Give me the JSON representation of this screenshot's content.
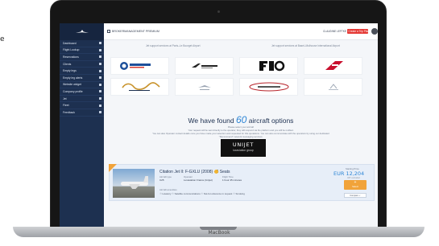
{
  "page_edge_text": "e",
  "laptop": {
    "brand": "MacBook"
  },
  "sidebar": {
    "items": [
      {
        "label": "Dashboard"
      },
      {
        "label": "Flight Lookup"
      },
      {
        "label": "Reservations"
      },
      {
        "label": "Clients"
      },
      {
        "label": "Empty legs"
      },
      {
        "label": "Empty leg alerts"
      },
      {
        "label": "Website widget"
      },
      {
        "label": "Company profile"
      },
      {
        "label": "Jet"
      },
      {
        "label": "Fleet"
      },
      {
        "label": "Feedback"
      }
    ]
  },
  "topbar": {
    "left_label": "BROKERMANAGEMENT PREMIUM",
    "cta_label": "+ Create a Trip Plan",
    "user_label": "CLAUDINE LEFTKE · Lorem Jets"
  },
  "operators": {
    "left_heading": "Jet support services at Paris–Le Bourget Airport",
    "right_heading": "Jet support services at Basel–Mulhouse International Airport",
    "logos": [
      {
        "name": "Universal Aviation"
      },
      {
        "name": "Dassault"
      },
      {
        "name": "FBO"
      },
      {
        "name": "TAG"
      },
      {
        "name": "Signature Flight Support"
      },
      {
        "name": "Jet Service"
      },
      {
        "name": "General Aviation Service"
      },
      {
        "name": "Amac Aerospace"
      }
    ]
  },
  "results": {
    "title_prefix": "We have found",
    "count": "60",
    "title_suffix": "aircraft options",
    "lines": [
      "Please select your aircraft",
      "Your request will be sent directly to the operator, they will respond via the platform and you will be notified.",
      "You can also Operator contact details once you have made your selection and requested for this quotations. You can also communicate with the operators by using our dedicated",
      "\"Recommend\" network messaging services."
    ]
  },
  "operator_logo": {
    "name": "UNIJET",
    "tagline": "luxaviation group"
  },
  "listing": {
    "title": "Citation Jet II: F-GXLU (2008) - 6 Seats",
    "meta_labels": [
      "Aircraft type",
      "Operator",
      "Flight Time"
    ],
    "meta_values": [
      "C25",
      "Luxaviation France (Unijet)",
      "1 hour 45 minutes"
    ],
    "amenities_label": "Aircraft amenities",
    "amenities": "☉ Lavatory   ☉ Satellite communications   ☉ Not-for-reference in request   ☉ Smoking",
    "from_label": "Starting Price",
    "price": "EUR 12,204",
    "tax_note": "VAT excluded",
    "book_symbol": "+",
    "book_label": "Select",
    "compare_label": "Compare ✓"
  },
  "colors": {
    "sidebar": "#1d3050",
    "accent_blue": "#2f86d6",
    "cta_red": "#e53935",
    "book_orange": "#f1a33a"
  }
}
